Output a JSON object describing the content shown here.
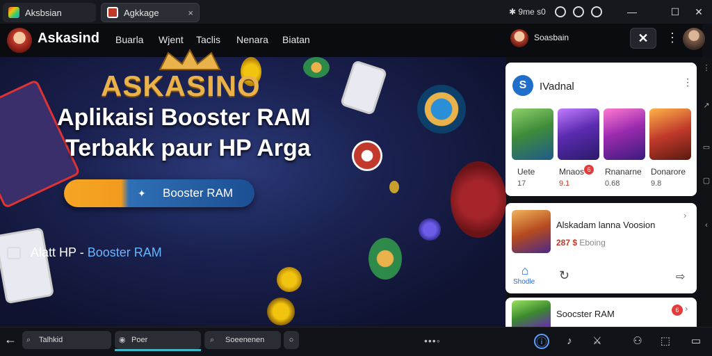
{
  "window": {
    "tab1_title": "Aksbsian",
    "tab2_title": "Agkkage",
    "tab_close": "×",
    "status_text": "✱ 9me s0",
    "minimize": "—",
    "maximize": "☐",
    "close": "✕"
  },
  "navbar": {
    "brand": "Askasind",
    "links": [
      "Buarla",
      "Wjent",
      "Taclis",
      "Nenara",
      "Biatan"
    ],
    "user_name": "Soasbain",
    "close_label": "✕",
    "menu": "⋮"
  },
  "hero": {
    "logo_text": "ASKASINO",
    "title_line1": "Aplikaisi Booster RAM",
    "title_line2": "Terbakk paur HP Arga",
    "cta_icon": "✦",
    "cta_label": "Booster RAM",
    "caption_prefix": "Alatt HP - ",
    "caption_accent": "Booster RAM"
  },
  "panel": {
    "logo_letter": "S",
    "title": "IVadnal",
    "menu": "⋮",
    "games": [
      {
        "name": "Uete",
        "score": "17"
      },
      {
        "name": "Mnaos",
        "score": "9.1"
      },
      {
        "name": "Rnanarne",
        "score": "0.68"
      },
      {
        "name": "Donarore",
        "score": "9.8"
      }
    ],
    "score_badge": "6",
    "featured": {
      "title": "Alskadam lanna Voosion",
      "price": "287 $",
      "price_note": "Eboing",
      "chevron": "›"
    },
    "home_label": "Shodle",
    "home_icon": "⌂",
    "share_icon": "↻",
    "share2_icon": "⇨",
    "bottom_item": {
      "title": "Soocster RAM",
      "badge": "6",
      "chevron": "›"
    }
  },
  "bottombar": {
    "back": "←",
    "pill1": "Talhkid",
    "pill2": "Poer",
    "pill3": "Soeenenen",
    "dots": "•••◦",
    "icons": [
      "ⓘ",
      "♪",
      "⚔",
      "⚇",
      "⬚",
      "▭"
    ]
  },
  "colors": {
    "accent_blue": "#2a6bd6",
    "brand_gold": "#e9b24a",
    "cta_orange": "#f5a623",
    "badge_red": "#e43b3b"
  }
}
